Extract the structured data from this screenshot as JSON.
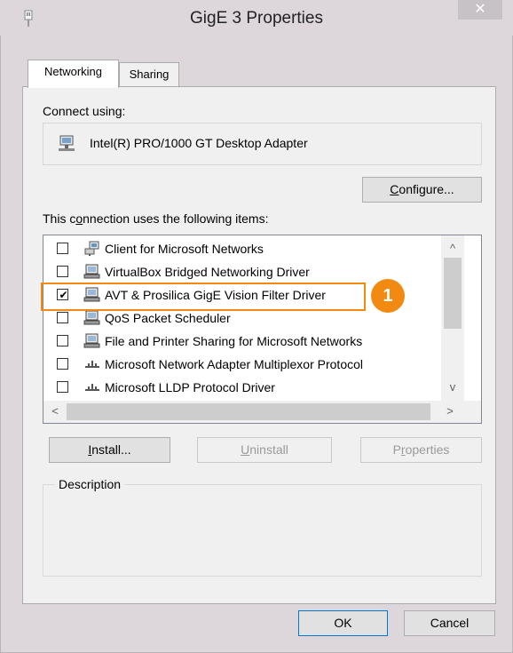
{
  "window": {
    "title": "GigE 3 Properties",
    "close_glyph": "✕",
    "icons": {
      "app": "network-plug-icon",
      "close": "close-icon"
    }
  },
  "tabs": [
    {
      "label": "Networking",
      "active": true
    },
    {
      "label": "Sharing",
      "active": false
    }
  ],
  "connect_using": {
    "label": "Connect using:",
    "adapter": "Intel(R) PRO/1000 GT Desktop Adapter",
    "adapter_icon": "network-adapter-icon",
    "configure_button": {
      "label_underlined": "C",
      "label_rest": "onfigure..."
    }
  },
  "items_section": {
    "label_before": "This c",
    "label_underlined": "o",
    "label_after": "nnection uses the following items:",
    "items": [
      {
        "label": "Client for Microsoft Networks",
        "checked": false,
        "icon": "network-client-icon"
      },
      {
        "label": "VirtualBox Bridged Networking Driver",
        "checked": false,
        "icon": "network-service-icon"
      },
      {
        "label": "AVT & Prosilica GigE Vision Filter Driver",
        "checked": true,
        "icon": "network-service-icon"
      },
      {
        "label": "QoS Packet Scheduler",
        "checked": false,
        "icon": "network-service-icon"
      },
      {
        "label": "File and Printer Sharing for Microsoft Networks",
        "checked": false,
        "icon": "network-service-icon"
      },
      {
        "label": "Microsoft Network Adapter Multiplexor Protocol",
        "checked": false,
        "icon": "network-protocol-icon"
      },
      {
        "label": "Microsoft LLDP Protocol Driver",
        "checked": false,
        "icon": "network-protocol-icon"
      }
    ],
    "check_glyph": "✔",
    "scroll_up": "^",
    "scroll_down": "v",
    "scroll_left": "<",
    "scroll_right": ">"
  },
  "callout": {
    "number": "1",
    "color": "#f28a12"
  },
  "buttons": {
    "install": {
      "underlined": "I",
      "rest": "nstall..."
    },
    "uninstall": {
      "underlined": "U",
      "rest": "ninstall"
    },
    "properties": {
      "before": "P",
      "underlined": "r",
      "rest": "operties"
    }
  },
  "description": {
    "label": "Description",
    "text": ""
  },
  "footer": {
    "ok": "OK",
    "cancel": "Cancel"
  }
}
